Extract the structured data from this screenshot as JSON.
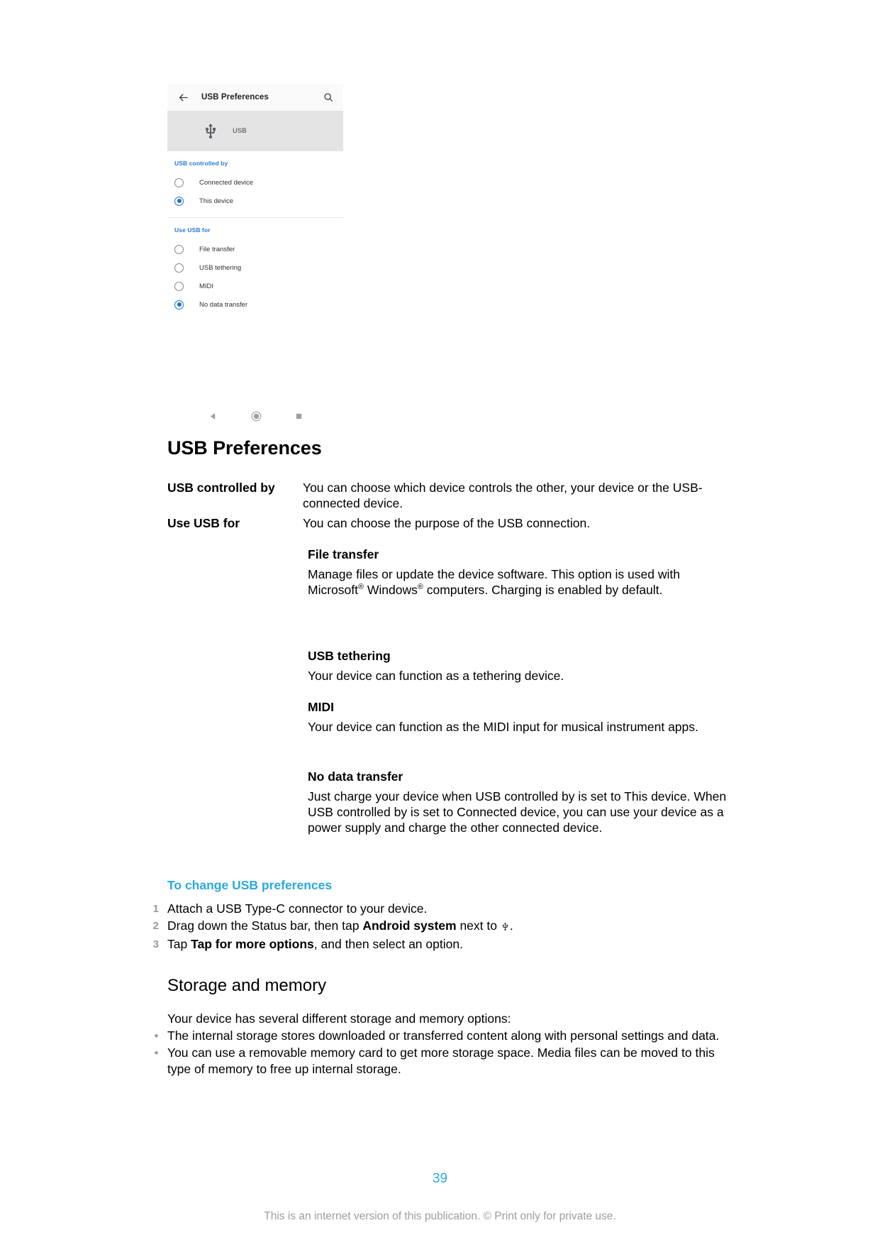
{
  "phone_screenshot": {
    "appbar": {
      "back_icon": "back-arrow-icon",
      "title": "USB Preferences",
      "search_icon": "search-icon"
    },
    "banner": {
      "icon": "usb-icon",
      "label": "USB"
    },
    "sections": [
      {
        "title": "USB controlled by",
        "options": [
          {
            "label": "Connected device",
            "selected": false
          },
          {
            "label": "This device",
            "selected": true
          }
        ]
      },
      {
        "title": "Use USB for",
        "options": [
          {
            "label": "File transfer",
            "selected": false
          },
          {
            "label": "USB tethering",
            "selected": false
          },
          {
            "label": "MIDI",
            "selected": false
          },
          {
            "label": "No data transfer",
            "selected": true
          }
        ]
      }
    ],
    "navbar": {
      "back": "nav-back-icon",
      "home": "nav-home-icon",
      "recents": "nav-recents-icon"
    },
    "colors": {
      "accent_blue": "#1a73c7",
      "section_header_blue": "#2a7bd4",
      "banner_grey": "#e4e4e4",
      "appbar_grey": "#fafafa"
    }
  },
  "document": {
    "heading": "USB Preferences",
    "definitions": [
      {
        "term": "USB controlled by",
        "description": "You can choose which device controls the other, your device or the USB-connected device."
      },
      {
        "term": "Use USB for",
        "description": "You can choose the purpose of the USB connection."
      }
    ],
    "sub_sections": [
      {
        "heading": "File transfer",
        "body_part1": "Manage files or update the device software. This option is used with Microsoft",
        "body_sup1": "®",
        "body_part2": " Windows",
        "body_sup2": "®",
        "body_part3": " computers. Charging is enabled by default."
      },
      {
        "heading": "USB tethering",
        "body": "Your device can function as a tethering device."
      },
      {
        "heading": "MIDI",
        "body": "Your device can function as the MIDI input for musical instrument apps."
      },
      {
        "heading": "No data transfer",
        "body": "Just charge your device when USB controlled by is set to This device. When USB controlled by is set to Connected device, you can use your device as a power supply and charge the other connected device."
      }
    ],
    "procedure": {
      "title": "To change USB preferences",
      "steps": [
        {
          "number": "1",
          "text_before": "Attach a USB Type-C connector to your device.",
          "bold": "",
          "text_after": ""
        },
        {
          "number": "2",
          "text_before": "Drag down the Status bar, then tap ",
          "bold": "Android system",
          "text_after": " next to "
        },
        {
          "number": "3",
          "text_before": "Tap ",
          "bold": "Tap for more options",
          "text_after": ", and then select an option."
        }
      ]
    },
    "storage_section": {
      "heading": "Storage and memory",
      "intro": "Your device has several different storage and memory options:",
      "bullets": [
        "The internal storage stores downloaded or transferred content along with personal settings and data.",
        "You can use a removable memory card to get more storage space. Media files can be moved to this type of memory to free up internal storage."
      ]
    }
  },
  "footer": {
    "page_number": "39",
    "copyright": "This is an internet version of this publication. © Print only for private use."
  }
}
